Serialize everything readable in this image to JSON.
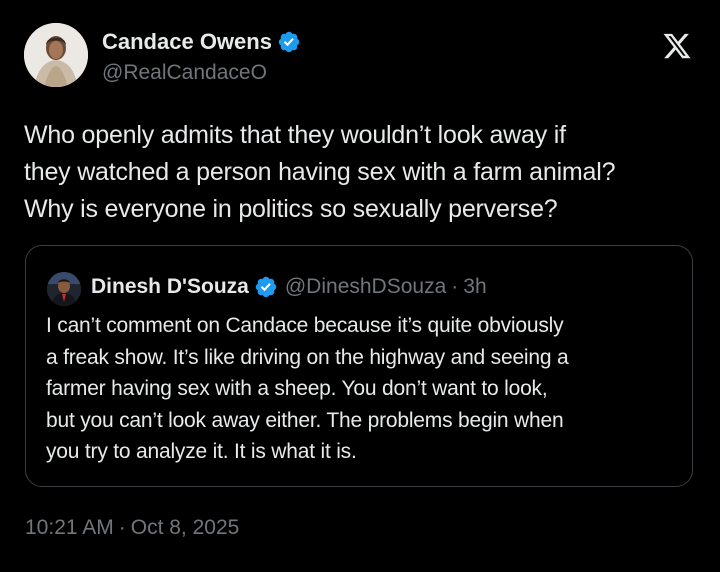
{
  "author": {
    "display_name": "Candace Owens",
    "handle": "@RealCandaceO",
    "verified_icon": "verified-badge-icon"
  },
  "brand": {
    "logo_icon": "x-logo-icon"
  },
  "tweet": {
    "text": "Who openly admits that they wouldn’t look away if\nthey watched a person having sex with a farm animal?\nWhy is everyone in politics so sexually perverse?",
    "time": "10:21 AM",
    "separator": "·",
    "date": "Oct 8, 2025"
  },
  "quoted_tweet": {
    "display_name": "Dinesh D'Souza",
    "handle": "@DineshDSouza",
    "separator": "·",
    "age": "3h",
    "text": "I can’t comment on Candace because it’s quite obviously\na freak show. It’s like driving on the highway and seeing a\nfarmer having sex with a sheep. You don’t want to look,\nbut you can’t look away either. The problems begin when\nyou try to analyze it. It is what it is."
  },
  "colors": {
    "background": "#000000",
    "primary_text": "#e7e9ea",
    "secondary_text": "#71767b",
    "verified_blue": "#1d9bf0",
    "quote_border": "#3a3d41"
  }
}
